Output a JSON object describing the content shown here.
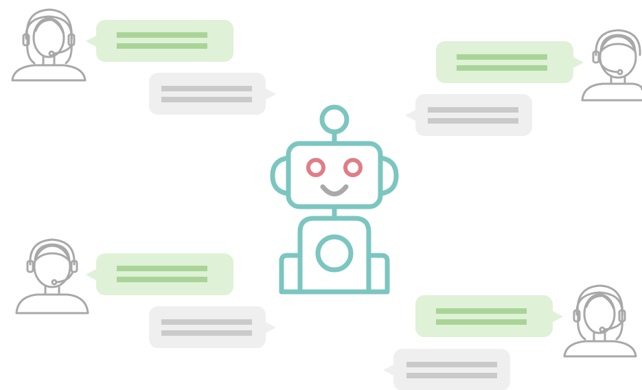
{
  "colors": {
    "background": "#ffffff",
    "robot": "#7bc6c0",
    "robot_eyes": "#e07d86",
    "robot_mouth": "#a9a9a9",
    "agent_outline": "#a8a8a8",
    "green_bubble_fill": "#dff1d7",
    "green_bubble_line": "#a9d497",
    "gray_bubble_fill": "#efefef",
    "gray_bubble_line": "#cacaca"
  },
  "icons": {
    "central": "robot-icon",
    "agent_female": "female-headset-agent-icon",
    "agent_male": "male-headset-agent-icon"
  },
  "conversations": [
    {
      "agent": "female",
      "position": "top-left",
      "agent_bubble": "green",
      "bot_bubble": "gray"
    },
    {
      "agent": "male",
      "position": "top-right",
      "agent_bubble": "green",
      "bot_bubble": "gray"
    },
    {
      "agent": "male",
      "position": "bottom-left",
      "agent_bubble": "green",
      "bot_bubble": "gray"
    },
    {
      "agent": "female",
      "position": "bottom-right",
      "agent_bubble": "green",
      "bot_bubble": "gray"
    }
  ]
}
